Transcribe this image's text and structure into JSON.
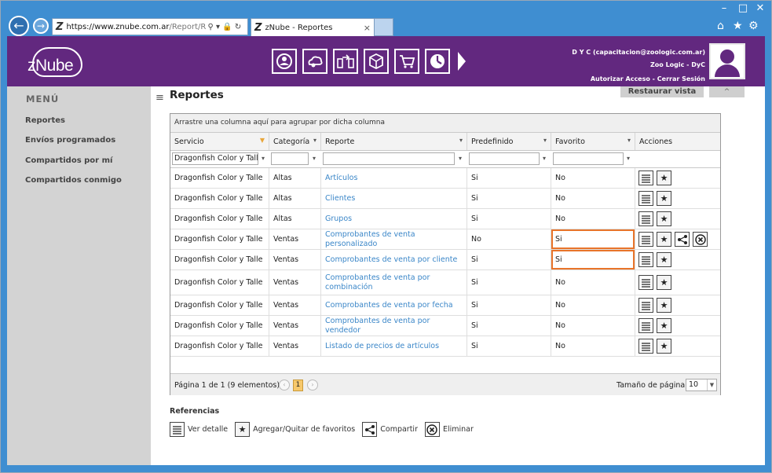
{
  "browser": {
    "url_host": "https://www.znube.com.ar",
    "url_path": "/Report/Repor",
    "tab_title": "zNube - Reportes",
    "address_logo": "Z"
  },
  "app": {
    "brand": "zNube",
    "user_line1": "D Y C (capacitacion@zoologic.com.ar)",
    "user_line2": "Zoo Logic - DyC",
    "authorize": "Autorizar Acceso",
    "separator": "-",
    "logout": "Cerrar Sesión",
    "modules": [
      "people-settings-icon",
      "cloud-settings-icon",
      "transfer-icon",
      "box-icon",
      "cart-icon",
      "clock-icon"
    ]
  },
  "sidebar": {
    "title": "MENÚ",
    "items": [
      {
        "label": "Reportes"
      },
      {
        "label": "Envíos programados"
      },
      {
        "label": "Compartidos por mí"
      },
      {
        "label": "Compartidos conmigo"
      }
    ]
  },
  "main": {
    "title": "Reportes",
    "restore_label": "Restaurar vista"
  },
  "grid": {
    "group_hint": "Arrastre una columna aquí para agrupar por dicha columna",
    "columns": [
      "Servicio",
      "Categoría",
      "Reporte",
      "Predefinido",
      "Favorito",
      "Acciones"
    ],
    "filters": {
      "servicio": "Dragonfish Color y Talle"
    },
    "rows": [
      {
        "servicio": "Dragonfish Color y Talle",
        "categoria": "Altas",
        "reporte": "Artículos",
        "predefinido": "Si",
        "favorito": "No"
      },
      {
        "servicio": "Dragonfish Color y Talle",
        "categoria": "Altas",
        "reporte": "Clientes",
        "predefinido": "Si",
        "favorito": "No"
      },
      {
        "servicio": "Dragonfish Color y Talle",
        "categoria": "Altas",
        "reporte": "Grupos",
        "predefinido": "Si",
        "favorito": "No"
      },
      {
        "servicio": "Dragonfish Color y Talle",
        "categoria": "Ventas",
        "reporte": "Comprobantes de venta personalizado",
        "predefinido": "No",
        "favorito": "Si"
      },
      {
        "servicio": "Dragonfish Color y Talle",
        "categoria": "Ventas",
        "reporte": "Comprobantes de venta por cliente",
        "predefinido": "Si",
        "favorito": "Si"
      },
      {
        "servicio": "Dragonfish Color y Talle",
        "categoria": "Ventas",
        "reporte": "Comprobantes de venta por combinación",
        "predefinido": "Si",
        "favorito": "No"
      },
      {
        "servicio": "Dragonfish Color y Talle",
        "categoria": "Ventas",
        "reporte": "Comprobantes de venta por fecha",
        "predefinido": "Si",
        "favorito": "No"
      },
      {
        "servicio": "Dragonfish Color y Talle",
        "categoria": "Ventas",
        "reporte": "Comprobantes de venta por vendedor",
        "predefinido": "Si",
        "favorito": "No"
      },
      {
        "servicio": "Dragonfish Color y Talle",
        "categoria": "Ventas",
        "reporte": "Listado de precios de artículos",
        "predefinido": "Si",
        "favorito": "No"
      }
    ],
    "pager": {
      "info": "Página 1 de 1 (9 elementos)",
      "current_page": "1",
      "page_size_label": "Tamaño de página:",
      "page_size": "10"
    }
  },
  "references": {
    "title": "Referencias",
    "items": [
      {
        "icon": "list-icon",
        "label": "Ver detalle"
      },
      {
        "icon": "star-icon",
        "label": "Agregar/Quitar de favoritos"
      },
      {
        "icon": "share-icon",
        "label": "Compartir"
      },
      {
        "icon": "delete-icon",
        "label": "Eliminar"
      }
    ]
  },
  "colors": {
    "brand_purple": "#62287f",
    "chrome_blue": "#3f8ed1",
    "link_blue": "#3a86c8",
    "highlight_orange": "#e8742a"
  }
}
